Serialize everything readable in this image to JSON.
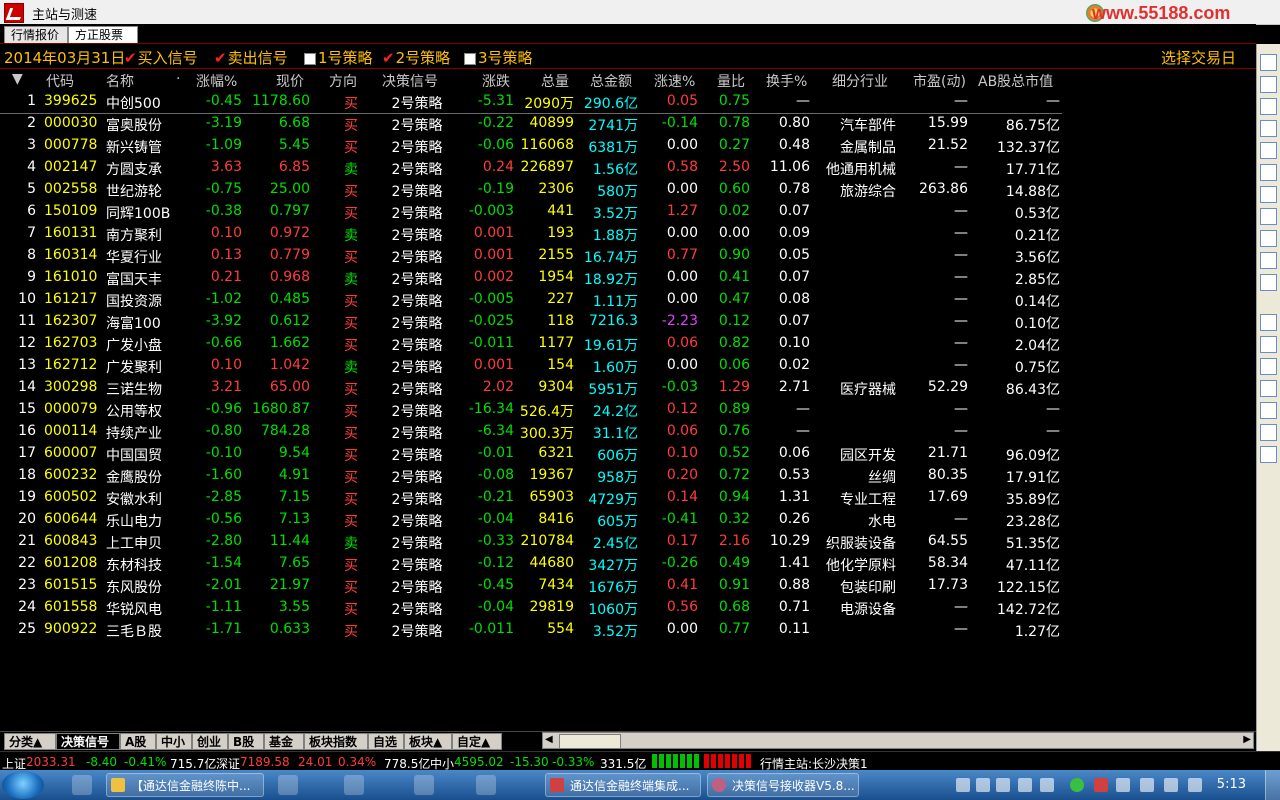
{
  "window": {
    "title": "主站与测速",
    "watermark": "www.55188.com"
  },
  "tabs": [
    {
      "label": "行情报价"
    },
    {
      "label": "方正股票池"
    }
  ],
  "signalbar": {
    "date": "2014年03月31日",
    "items": [
      {
        "label": "买入信号",
        "checked": true
      },
      {
        "label": "卖出信号",
        "checked": true
      },
      {
        "label": "1号策略",
        "checked": false
      },
      {
        "label": "2号策略",
        "checked": true
      },
      {
        "label": "3号策略",
        "checked": false
      }
    ],
    "right_label": "选择交易日"
  },
  "columns": [
    "代码",
    "名称",
    "·",
    "涨幅%",
    "现价",
    "方向",
    "决策信号",
    "涨跌",
    "总量",
    "总金额",
    "涨速%",
    "量比",
    "换手%",
    "细分行业",
    "市盈(动)",
    "AB股总市值"
  ],
  "colors": {
    "up": "#ff3c3c",
    "down": "#00e000",
    "flat": "#ffffff",
    "purple": "#e040ff",
    "code": "#ffff00",
    "name": "#ffffff",
    "vol": "#ffff00",
    "amt": "#00ffff",
    "hdr": "#c8c8c8"
  },
  "rows": [
    {
      "no": "1",
      "code": "399625",
      "name": "中创500",
      "pct": "-0.45",
      "price": "1178.60",
      "dir": "买",
      "sig": "2号策略",
      "chg": "-5.31",
      "vol": "2090万",
      "amt": "290.6亿",
      "speed": "0.05",
      "qr": "0.75",
      "turn": "—",
      "ind": "",
      "pe": "—",
      "mcap": "—"
    },
    {
      "no": "2",
      "code": "000030",
      "name": "富奥股份",
      "pct": "-3.19",
      "price": "6.68",
      "dir": "买",
      "sig": "2号策略",
      "chg": "-0.22",
      "vol": "40899",
      "amt": "2741万",
      "speed": "-0.14",
      "qr": "0.78",
      "turn": "0.80",
      "ind": "汽车部件",
      "pe": "15.99",
      "mcap": "86.75亿"
    },
    {
      "no": "3",
      "code": "000778",
      "name": "新兴铸管",
      "pct": "-1.09",
      "price": "5.45",
      "dir": "买",
      "sig": "2号策略",
      "chg": "-0.06",
      "vol": "116068",
      "amt": "6381万",
      "speed": "0.00",
      "qr": "0.27",
      "turn": "0.48",
      "ind": "金属制品",
      "pe": "21.52",
      "mcap": "132.37亿"
    },
    {
      "no": "4",
      "code": "002147",
      "name": "方圆支承",
      "pct": "3.63",
      "price": "6.85",
      "dir": "卖",
      "sig": "2号策略",
      "chg": "0.24",
      "vol": "226897",
      "amt": "1.56亿",
      "speed": "0.58",
      "qr": "2.50",
      "turn": "11.06",
      "ind": "他通用机械",
      "pe": "—",
      "mcap": "17.71亿"
    },
    {
      "no": "5",
      "code": "002558",
      "name": "世纪游轮",
      "pct": "-0.75",
      "price": "25.00",
      "dir": "买",
      "sig": "2号策略",
      "chg": "-0.19",
      "vol": "2306",
      "amt": "580万",
      "speed": "0.00",
      "qr": "0.60",
      "turn": "0.78",
      "ind": "旅游综合",
      "pe": "263.86",
      "mcap": "14.88亿"
    },
    {
      "no": "6",
      "code": "150109",
      "name": "同辉100B",
      "pct": "-0.38",
      "price": "0.797",
      "dir": "买",
      "sig": "2号策略",
      "chg": "-0.003",
      "vol": "441",
      "amt": "3.52万",
      "speed": "1.27",
      "qr": "0.02",
      "turn": "0.07",
      "ind": "",
      "pe": "—",
      "mcap": "0.53亿"
    },
    {
      "no": "7",
      "code": "160131",
      "name": "南方聚利",
      "pct": "0.10",
      "price": "0.972",
      "dir": "卖",
      "sig": "2号策略",
      "chg": "0.001",
      "vol": "193",
      "amt": "1.88万",
      "speed": "0.00",
      "qr": "0.00",
      "turn": "0.09",
      "ind": "",
      "pe": "—",
      "mcap": "0.21亿"
    },
    {
      "no": "8",
      "code": "160314",
      "name": "华夏行业",
      "pct": "0.13",
      "price": "0.779",
      "dir": "买",
      "sig": "2号策略",
      "chg": "0.001",
      "vol": "2155",
      "amt": "16.74万",
      "speed": "0.77",
      "qr": "0.90",
      "turn": "0.05",
      "ind": "",
      "pe": "—",
      "mcap": "3.56亿"
    },
    {
      "no": "9",
      "code": "161010",
      "name": "富国天丰",
      "pct": "0.21",
      "price": "0.968",
      "dir": "卖",
      "sig": "2号策略",
      "chg": "0.002",
      "vol": "1954",
      "amt": "18.92万",
      "speed": "0.00",
      "qr": "0.41",
      "turn": "0.07",
      "ind": "",
      "pe": "—",
      "mcap": "2.85亿"
    },
    {
      "no": "10",
      "code": "161217",
      "name": "国投资源",
      "pct": "-1.02",
      "price": "0.485",
      "dir": "买",
      "sig": "2号策略",
      "chg": "-0.005",
      "vol": "227",
      "amt": "1.11万",
      "speed": "0.00",
      "qr": "0.47",
      "turn": "0.08",
      "ind": "",
      "pe": "—",
      "mcap": "0.14亿"
    },
    {
      "no": "11",
      "code": "162307",
      "name": "海富100",
      "pct": "-3.92",
      "price": "0.612",
      "dir": "买",
      "sig": "2号策略",
      "chg": "-0.025",
      "vol": "118",
      "amt": "7216.3",
      "speed": "-2.23",
      "qr": "0.12",
      "turn": "0.07",
      "ind": "",
      "pe": "—",
      "mcap": "0.10亿"
    },
    {
      "no": "12",
      "code": "162703",
      "name": "广发小盘",
      "pct": "-0.66",
      "price": "1.662",
      "dir": "买",
      "sig": "2号策略",
      "chg": "-0.011",
      "vol": "1177",
      "amt": "19.61万",
      "speed": "0.06",
      "qr": "0.82",
      "turn": "0.10",
      "ind": "",
      "pe": "—",
      "mcap": "2.04亿"
    },
    {
      "no": "13",
      "code": "162712",
      "name": "广发聚利",
      "pct": "0.10",
      "price": "1.042",
      "dir": "卖",
      "sig": "2号策略",
      "chg": "0.001",
      "vol": "154",
      "amt": "1.60万",
      "speed": "0.00",
      "qr": "0.06",
      "turn": "0.02",
      "ind": "",
      "pe": "—",
      "mcap": "0.75亿"
    },
    {
      "no": "14",
      "code": "300298",
      "name": "三诺生物",
      "pct": "3.21",
      "price": "65.00",
      "dir": "买",
      "sig": "2号策略",
      "chg": "2.02",
      "vol": "9304",
      "amt": "5951万",
      "speed": "-0.03",
      "qr": "1.29",
      "turn": "2.71",
      "ind": "医疗器械",
      "pe": "52.29",
      "mcap": "86.43亿"
    },
    {
      "no": "15",
      "code": "000079",
      "name": "公用等权",
      "pct": "-0.96",
      "price": "1680.87",
      "dir": "买",
      "sig": "2号策略",
      "chg": "-16.34",
      "vol": "526.4万",
      "amt": "24.2亿",
      "speed": "0.12",
      "qr": "0.89",
      "turn": "—",
      "ind": "",
      "pe": "—",
      "mcap": "—"
    },
    {
      "no": "16",
      "code": "000114",
      "name": "持续产业",
      "pct": "-0.80",
      "price": "784.28",
      "dir": "买",
      "sig": "2号策略",
      "chg": "-6.34",
      "vol": "300.3万",
      "amt": "31.1亿",
      "speed": "0.06",
      "qr": "0.76",
      "turn": "—",
      "ind": "",
      "pe": "—",
      "mcap": "—"
    },
    {
      "no": "17",
      "code": "600007",
      "name": "中国国贸",
      "pct": "-0.10",
      "price": "9.54",
      "dir": "买",
      "sig": "2号策略",
      "chg": "-0.01",
      "vol": "6321",
      "amt": "606万",
      "speed": "0.10",
      "qr": "0.52",
      "turn": "0.06",
      "ind": "园区开发",
      "pe": "21.71",
      "mcap": "96.09亿"
    },
    {
      "no": "18",
      "code": "600232",
      "name": "金鹰股份",
      "pct": "-1.60",
      "price": "4.91",
      "dir": "买",
      "sig": "2号策略",
      "chg": "-0.08",
      "vol": "19367",
      "amt": "958万",
      "speed": "0.20",
      "qr": "0.72",
      "turn": "0.53",
      "ind": "丝绸",
      "pe": "80.35",
      "mcap": "17.91亿"
    },
    {
      "no": "19",
      "code": "600502",
      "name": "安徽水利",
      "pct": "-2.85",
      "price": "7.15",
      "dir": "买",
      "sig": "2号策略",
      "chg": "-0.21",
      "vol": "65903",
      "amt": "4729万",
      "speed": "0.14",
      "qr": "0.94",
      "turn": "1.31",
      "ind": "专业工程",
      "pe": "17.69",
      "mcap": "35.89亿"
    },
    {
      "no": "20",
      "code": "600644",
      "name": "乐山电力",
      "pct": "-0.56",
      "price": "7.13",
      "dir": "买",
      "sig": "2号策略",
      "chg": "-0.04",
      "vol": "8416",
      "amt": "605万",
      "speed": "-0.41",
      "qr": "0.32",
      "turn": "0.26",
      "ind": "水电",
      "pe": "—",
      "mcap": "23.28亿"
    },
    {
      "no": "21",
      "code": "600843",
      "name": "上工申贝",
      "pct": "-2.80",
      "price": "11.44",
      "dir": "卖",
      "sig": "2号策略",
      "chg": "-0.33",
      "vol": "210784",
      "amt": "2.45亿",
      "speed": "0.17",
      "qr": "2.16",
      "turn": "10.29",
      "ind": "织服装设备",
      "pe": "64.55",
      "mcap": "51.35亿"
    },
    {
      "no": "22",
      "code": "601208",
      "name": "东材科技",
      "pct": "-1.54",
      "price": "7.65",
      "dir": "买",
      "sig": "2号策略",
      "chg": "-0.12",
      "vol": "44680",
      "amt": "3427万",
      "speed": "-0.26",
      "qr": "0.49",
      "turn": "1.41",
      "ind": "他化学原料",
      "pe": "58.34",
      "mcap": "47.11亿"
    },
    {
      "no": "23",
      "code": "601515",
      "name": "东风股份",
      "pct": "-2.01",
      "price": "21.97",
      "dir": "买",
      "sig": "2号策略",
      "chg": "-0.45",
      "vol": "7434",
      "amt": "1676万",
      "speed": "0.41",
      "qr": "0.91",
      "turn": "0.88",
      "ind": "包装印刷",
      "pe": "17.73",
      "mcap": "122.15亿"
    },
    {
      "no": "24",
      "code": "601558",
      "name": "华锐风电",
      "pct": "-1.11",
      "price": "3.55",
      "dir": "买",
      "sig": "2号策略",
      "chg": "-0.04",
      "vol": "29819",
      "amt": "1060万",
      "speed": "0.56",
      "qr": "0.68",
      "turn": "0.71",
      "ind": "电源设备",
      "pe": "—",
      "mcap": "142.72亿"
    },
    {
      "no": "25",
      "code": "900922",
      "name": "三毛Ｂ股",
      "pct": "-1.71",
      "price": "0.633",
      "dir": "买",
      "sig": "2号策略",
      "chg": "-0.011",
      "vol": "554",
      "amt": "3.52万",
      "speed": "0.00",
      "qr": "0.77",
      "turn": "0.11",
      "ind": "",
      "pe": "—",
      "mcap": "1.27亿"
    }
  ],
  "bottom_tabs": [
    {
      "label": "分类▲",
      "active": false
    },
    {
      "label": "决策信号",
      "active": true
    },
    {
      "label": "A股",
      "active": false
    },
    {
      "label": "中小",
      "active": false
    },
    {
      "label": "创业",
      "active": false
    },
    {
      "label": "B股",
      "active": false
    },
    {
      "label": "基金",
      "active": false
    },
    {
      "label": "板块指数",
      "active": false
    },
    {
      "label": "自选",
      "active": false
    },
    {
      "label": "板块▲",
      "active": false
    },
    {
      "label": "自定▲",
      "active": false
    }
  ],
  "status": {
    "sh_label": "上证",
    "sh_val": "2033.31",
    "sh_chg": "-8.40",
    "sh_pct": "-0.41%",
    "sh_amt": "715.7亿",
    "sz_label": "深证",
    "sz_val": "7189.58",
    "sz_chg": "24.01",
    "sz_pct": "0.34%",
    "sz_amt": "778.5亿",
    "zx_label": "中小",
    "zx_val": "4595.02",
    "zx_chg": "-15.30",
    "zx_pct": "-0.33%",
    "zx_amt": "331.5亿",
    "server": "行情主站:长沙决策1"
  },
  "taskbar": {
    "buttons": [
      "【通达信金融终陈中...",
      "通达信金融终端集成...",
      "决策信号接收器V5.8..."
    ],
    "time": "5:13"
  }
}
